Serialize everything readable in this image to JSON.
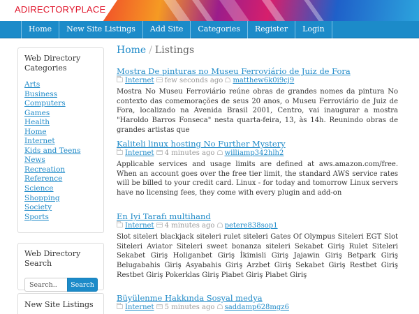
{
  "brand": "ADIRECTORYPLACE",
  "nav": [
    "Home",
    "New Site Listings",
    "Add Site",
    "Categories",
    "Register",
    "Login"
  ],
  "sidebar": {
    "categories_title": "Web Directory Categories",
    "categories": [
      "Arts",
      "Business",
      "Computers",
      "Games",
      "Health",
      "Home",
      "Internet",
      "Kids and Teens",
      "News",
      "Recreation",
      "Reference",
      "Science",
      "Shopping",
      "Society",
      "Sports"
    ],
    "search_title": "Web Directory Search",
    "search_placeholder": "Search..",
    "search_button": "Search",
    "new_listings_title": "New Site Listings"
  },
  "breadcrumb": {
    "home": "Home",
    "separator": "/",
    "current": "Listings"
  },
  "listings": [
    {
      "title": "Mostra De pinturas no Museu Ferroviário de Juiz de Fora",
      "category": "Internet",
      "time": "few seconds ago",
      "user": "matthew6k0i9cj9",
      "description": "Mostra No Museu Ferroviário reúne obras de grandes nomes da pintura No contexto das comemorações de seus 20 anos, o Museu Ferroviário de Juiz de Fora, localizado na Avenida Brasil 2001, Centro, vai inaugurar a mostra \"Haroldo Barros Fonseca\" nesta quarta-feira, 13, às 14h. Reunindo obras de grandes artistas que"
    },
    {
      "title": "Kaliteli linux hosting No Further Mystery",
      "category": "Internet",
      "time": "4 minutes ago",
      "user": "williamp342hlh2",
      "description": "Applicable services and usage limits are defined at aws.amazon.com/free. When an account goes over the free tier limit, the standard AWS service rates will be billed to your credit card. Linux - for today and tomorrow Linux servers have no licensing fees, they come with every plugin and add-on"
    },
    {
      "title": "En Iyi Tarafı multihand",
      "category": "Internet",
      "time": "4 minutes ago",
      "user": "petere838sop1",
      "description": "Slot siteleri blackjack siteleri rulet siteleri Gates Of Olympus Siteleri EGT Slot Siteleri Aviator Siteleri sweet bonanza siteleri Sekabet Giriş Rulet Siteleri Sekabet Giriş Holiganbet Giriş İkimisli Giriş Jajawin Giriş Betpark Giriş Belugabahis Giriş Asyabahis Giriş Arzbet Giriş Sekabet Giriş Restbet Giriş Restbet Giriş Pokerklas Giriş Piabet Giriş Piabet Giriş"
    },
    {
      "title": "Büyülenme Hakkında Sosyal medya",
      "category": "Internet",
      "time": "5 minutes ago",
      "user": "saddamp628mgz6",
      "description": ""
    }
  ]
}
